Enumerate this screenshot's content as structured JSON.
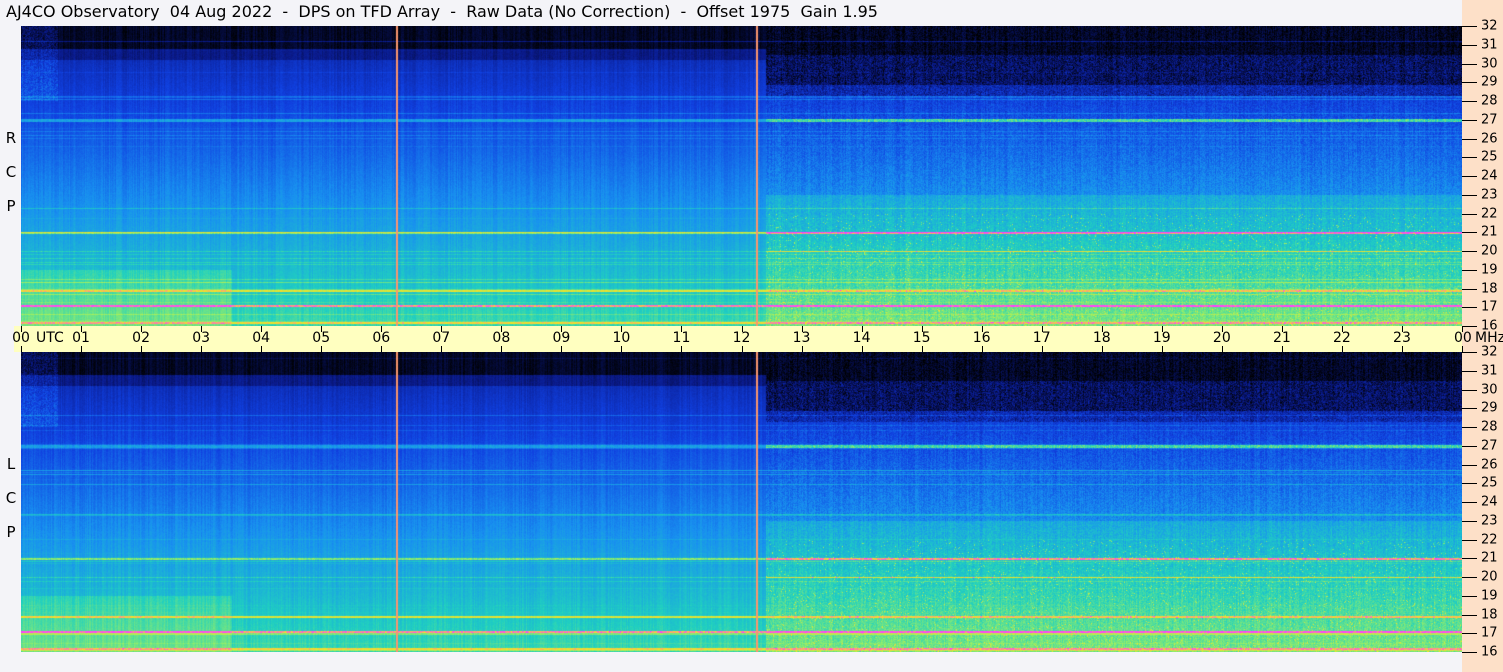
{
  "title": "AJ4CO Observatory  04 Aug 2022  -  DPS on TFD Array  -  Raw Data (No Correction)  -  Offset 1975  Gain 1.95",
  "chart_data": {
    "type": "heatmap",
    "title": "AJ4CO Observatory  04 Aug 2022  -  DPS on TFD Array  -  Raw Data (No Correction)  -  Offset 1975  Gain 1.95",
    "xlabel": "UTC",
    "ylabel": "MHz",
    "x_range": [
      0,
      24
    ],
    "y_range": [
      16,
      32
    ],
    "x_ticks": [
      "00",
      "01",
      "02",
      "03",
      "04",
      "05",
      "06",
      "07",
      "08",
      "09",
      "10",
      "11",
      "12",
      "13",
      "14",
      "15",
      "16",
      "17",
      "18",
      "19",
      "20",
      "21",
      "22",
      "23",
      "00"
    ],
    "y_ticks": [
      "16",
      "17",
      "18",
      "19",
      "20",
      "21",
      "22",
      "23",
      "24",
      "25",
      "26",
      "27",
      "28",
      "29",
      "30",
      "31",
      "32"
    ],
    "panels": [
      {
        "name": "RCP",
        "label": [
          "R",
          "C",
          "P"
        ]
      },
      {
        "name": "LCP",
        "label": [
          "L",
          "C",
          "P"
        ]
      }
    ],
    "vertical_markers_utc": [
      6.25,
      12.25
    ],
    "persistent_bands_mhz": [
      27.0,
      21.0,
      20.0,
      17.9,
      17.1,
      16.2
    ],
    "colormap": [
      "#000000",
      "#0a1a8a",
      "#1040e0",
      "#1890f0",
      "#20d0c0",
      "#a0f060",
      "#ffe020",
      "#ff40ff"
    ]
  }
}
